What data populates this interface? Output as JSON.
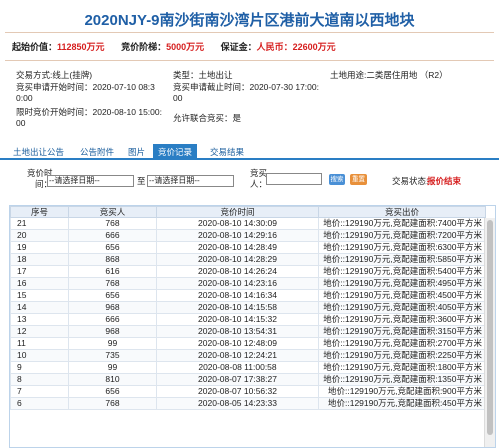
{
  "title": "2020NJY-9南沙街南沙湾片区港前大道南以西地块",
  "price_bar": {
    "start_label": "起始价值：",
    "start_value": "112850万元",
    "step_label": "竞价阶梯：",
    "step_value": "5000万元",
    "deposit_label": "保证金：",
    "deposit_value": "人民币：22600万元"
  },
  "info": {
    "trade_method": "交易方式:线上(挂牌)",
    "type": "类型：土地出让",
    "land_use": "土地用途:二类居住用地 （R2）",
    "apply_start_a": "竞买申请开始时间：2020-07-10 08:3",
    "apply_start_b": "0:00",
    "apply_end": "竞买申请截止时间：2020-07-30 17:00:",
    "apply_end_b": "00",
    "bid_start": "限时竞价开始时间：2020-08-10 15:00:",
    "bid_start_b": "00",
    "joint_bid": "允许联合竞买：是"
  },
  "tabs": [
    {
      "label": "土地出让公告"
    },
    {
      "label": "公告附件"
    },
    {
      "label": "图片"
    },
    {
      "label": "竞价记录"
    },
    {
      "label": "交易结果"
    }
  ],
  "filter": {
    "bid_time_label_1": "竞价时",
    "bid_time_label_2": "间：",
    "date_from_placeholder": "--请选择日期--",
    "to_label": "至",
    "date_to_placeholder": "--请选择日期--",
    "bidder_label_1": "竞买",
    "bidder_label_2": "人：",
    "search_btn": "搜索",
    "reset_btn": "重置",
    "status_label": "交易状态:",
    "status_value": "报价结束"
  },
  "table": {
    "headers": [
      "序号",
      "竞买人",
      "竞价时间",
      "竞买出价"
    ],
    "rows": [
      [
        "21",
        "768",
        "2020-08-10 14:30:09",
        "地价::129190万元,竞配建面积:7400平方米"
      ],
      [
        "20",
        "666",
        "2020-08-10 14:29:16",
        "地价::129190万元,竞配建面积:7200平方米"
      ],
      [
        "19",
        "656",
        "2020-08-10 14:28:49",
        "地价::129190万元,竞配建面积:6300平方米"
      ],
      [
        "18",
        "868",
        "2020-08-10 14:28:29",
        "地价::129190万元,竞配建面积:5850平方米"
      ],
      [
        "17",
        "616",
        "2020-08-10 14:26:24",
        "地价::129190万元,竞配建面积:5400平方米"
      ],
      [
        "16",
        "768",
        "2020-08-10 14:23:16",
        "地价::129190万元,竞配建面积:4950平方米"
      ],
      [
        "15",
        "656",
        "2020-08-10 14:16:34",
        "地价::129190万元,竞配建面积:4500平方米"
      ],
      [
        "14",
        "968",
        "2020-08-10 14:15:58",
        "地价::129190万元,竞配建面积:4050平方米"
      ],
      [
        "13",
        "666",
        "2020-08-10 14:15:32",
        "地价::129190万元,竞配建面积:3600平方米"
      ],
      [
        "12",
        "968",
        "2020-08-10 13:54:31",
        "地价::129190万元,竞配建面积:3150平方米"
      ],
      [
        "11",
        "99",
        "2020-08-10 12:48:09",
        "地价::129190万元,竞配建面积:2700平方米"
      ],
      [
        "10",
        "735",
        "2020-08-10 12:24:21",
        "地价::129190万元,竞配建面积:2250平方米"
      ],
      [
        "9",
        "99",
        "2020-08-08 11:00:58",
        "地价::129190万元,竞配建面积:1800平方米"
      ],
      [
        "8",
        "810",
        "2020-08-07 17:38:27",
        "地价::129190万元,竞配建面积:1350平方米"
      ],
      [
        "7",
        "656",
        "2020-08-07 10:56:32",
        "地价::129190万元,竞配建面积:900平方米"
      ],
      [
        "6",
        "768",
        "2020-08-05 14:23:33",
        "地价::129190万元,竞配建面积:450平方米"
      ]
    ]
  },
  "colors": {
    "title_blue": "#1f5fa6",
    "accent_blue": "#2a7ec4",
    "price_red": "#d61f1f"
  }
}
